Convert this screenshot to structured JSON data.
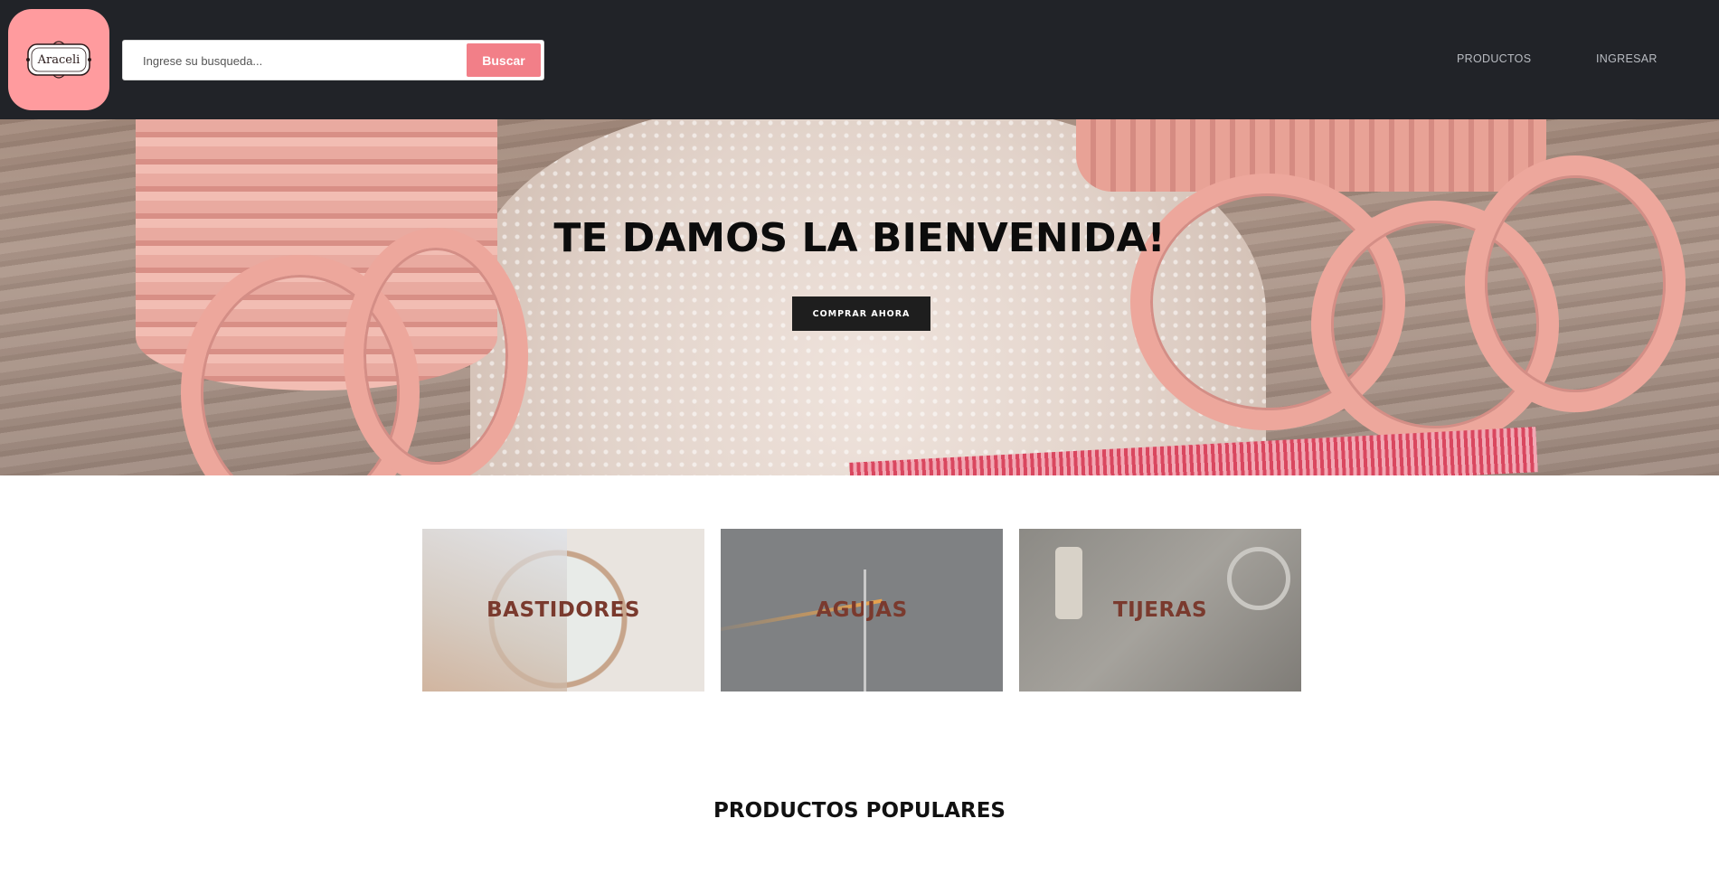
{
  "header": {
    "logo_text": "Araceli",
    "search": {
      "placeholder": "Ingrese su busqueda...",
      "button_label": "Buscar"
    },
    "nav": [
      {
        "label": "PRODUCTOS"
      },
      {
        "label": "INGRESAR"
      }
    ]
  },
  "hero": {
    "title": "TE DAMOS LA BIENVENIDA!",
    "cta_label": "COMPRAR AHORA"
  },
  "categories": [
    {
      "label": "BASTIDORES"
    },
    {
      "label": "AGUJAS"
    },
    {
      "label": "TIJERAS"
    }
  ],
  "popular": {
    "title": "PRODUCTOS POPULARES"
  },
  "colors": {
    "header_bg": "#212328",
    "logo_bg": "#ff9b9e",
    "search_button": "#f27f88",
    "category_text": "#7a3a2e"
  }
}
